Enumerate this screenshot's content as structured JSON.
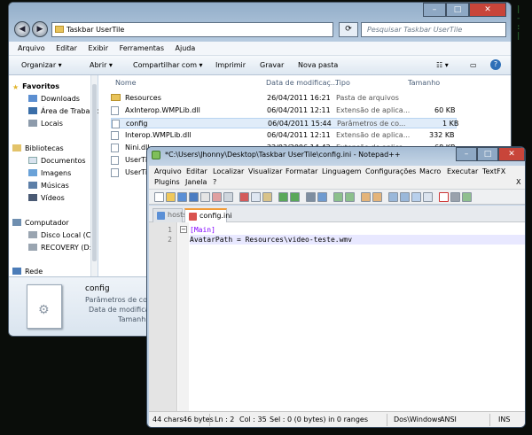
{
  "explorer": {
    "address_path": "Taskbar UserTile",
    "search_placeholder": "Pesquisar Taskbar UserTile",
    "menu": [
      "Arquivo",
      "Editar",
      "Exibir",
      "Ferramentas",
      "Ajuda"
    ],
    "toolbar": {
      "organize": "Organizar ▾",
      "open": "Abrir ▾",
      "share": "Compartilhar com ▾",
      "print": "Imprimir",
      "burn": "Gravar",
      "new_folder": "Nova pasta"
    },
    "sidebar": {
      "favorites": "Favoritos",
      "downloads": "Downloads",
      "desktop": "Área de Trabalho",
      "recent": "Locais",
      "libraries": "Bibliotecas",
      "documents": "Documentos",
      "images": "Imagens",
      "music": "Músicas",
      "videos": "Vídeos",
      "computer": "Computador",
      "local_disk": "Disco Local (C:)",
      "recovery": "RECOVERY (D:)",
      "network": "Rede"
    },
    "columns": {
      "name": "Nome",
      "date": "Data de modificaç...",
      "type": "Tipo",
      "size": "Tamanho"
    },
    "files": [
      {
        "name": "Resources",
        "date": "26/04/2011 16:21",
        "type": "Pasta de arquivos",
        "size": ""
      },
      {
        "name": "AxInterop.WMPLib.dll",
        "date": "06/04/2011 12:11",
        "type": "Extensão de aplica...",
        "size": "60 KB"
      },
      {
        "name": "config",
        "date": "06/04/2011 15:44",
        "type": "Parâmetros de co...",
        "size": "1 KB"
      },
      {
        "name": "Interop.WMPLib.dll",
        "date": "06/04/2011 12:11",
        "type": "Extensão de aplica...",
        "size": "332 KB"
      },
      {
        "name": "Nini.dll",
        "date": "22/03/2006 14:42",
        "type": "Extensão de aplica...",
        "size": "68 KB"
      },
      {
        "name": "UserTil",
        "date": "",
        "type": "",
        "size": ""
      },
      {
        "name": "UserTil",
        "date": "",
        "type": "",
        "size": ""
      }
    ],
    "details": {
      "name": "config",
      "type": "Parâmetros de conf",
      "modified": "Data de modificaç",
      "size": "Tamanh"
    }
  },
  "notepad": {
    "title": "*C:\\Users\\Jhonny\\Desktop\\Taskbar UserTile\\config.ini - Notepad++",
    "menu_row1": [
      "Arquivo",
      "Editar",
      "Localizar",
      "Visualizar",
      "Formatar",
      "Linguagem",
      "Configurações",
      "Macro",
      "Executar",
      "TextFX"
    ],
    "menu_row2": [
      "Plugins",
      "Janela",
      "?"
    ],
    "close_doc": "X",
    "tabs": [
      {
        "label": "hosts",
        "active": false
      },
      {
        "label": "config.ini",
        "active": true
      }
    ],
    "lines": [
      {
        "num": "1",
        "text": "[Main]"
      },
      {
        "num": "2",
        "text": "AvatarPath = Resources\\video-teste.wmv"
      }
    ],
    "status": {
      "chars": "44 chars",
      "bytes": "46 bytes",
      "ln": "Ln : 2",
      "col": "Col : 35",
      "sel": "Sel : 0 (0 bytes) in 0 ranges",
      "eol": "Dos\\Windows",
      "encoding": "ANSI",
      "mode": "INS"
    }
  },
  "colors": {
    "explorer_frame": "#c7d6e6",
    "npp_frame": "#c0d2e6",
    "section_bracket": "#8000ff",
    "current_line": "#e8e8ff",
    "active_tab_accent": "#f29c38"
  }
}
